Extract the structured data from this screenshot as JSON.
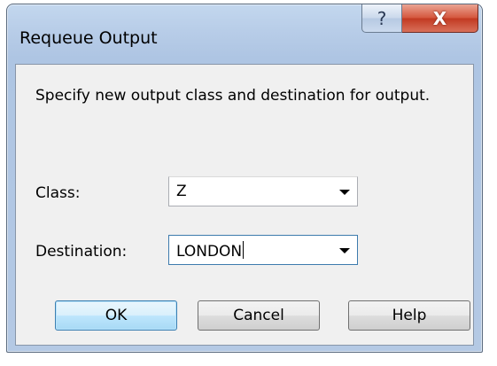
{
  "dialog": {
    "title": "Requeue Output",
    "help_glyph": "?",
    "close_glyph": "X"
  },
  "content": {
    "instruction": "Specify new output class and destination for output.",
    "class_label": "Class:",
    "class_value": "Z",
    "destination_label": "Destination:",
    "destination_value": "LONDON"
  },
  "buttons": {
    "ok": "OK",
    "cancel": "Cancel",
    "help": "Help"
  },
  "icons": {
    "dropdown": "chevron-down-icon",
    "close": "close-icon",
    "help": "help-icon"
  },
  "colors": {
    "title_bar": "#b8cde8",
    "close_button": "#c9452c",
    "default_button_border": "#3c7fb1",
    "client_bg": "#f0f0f0"
  }
}
